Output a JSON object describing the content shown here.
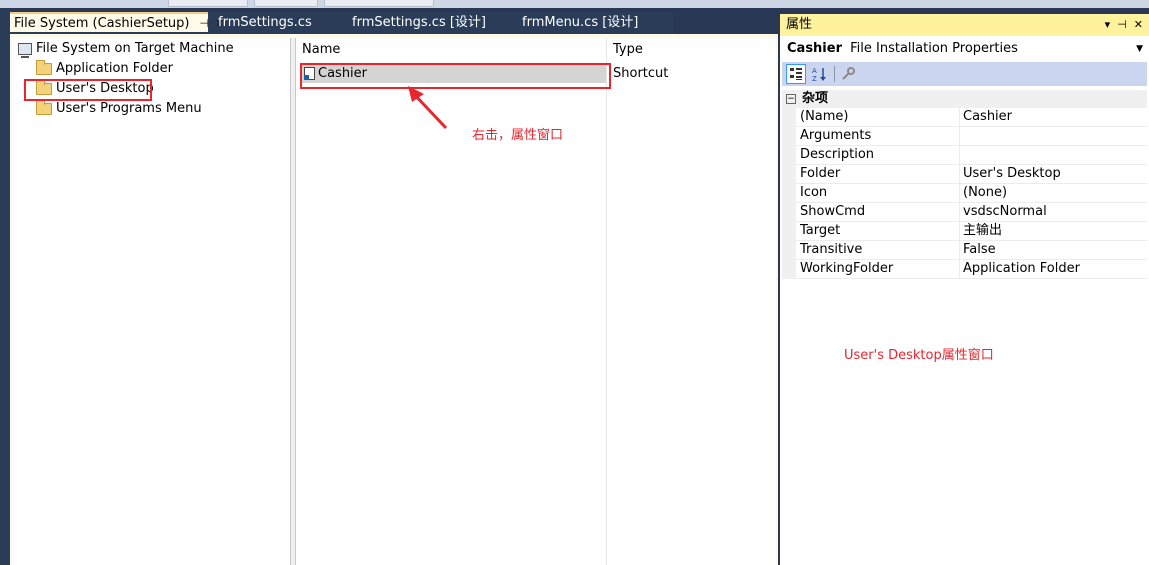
{
  "document_tabs": [
    {
      "label": "File System (CashierSetup)",
      "active": true,
      "pin": "⊣",
      "close": "✕"
    },
    {
      "label": "frmSettings.cs",
      "active": false
    },
    {
      "label": "frmSettings.cs [设计]",
      "active": false
    },
    {
      "label": "frmMenu.cs [设计]",
      "active": false
    }
  ],
  "tree": {
    "root": "File System on Target Machine",
    "items": [
      "Application Folder",
      "User's Desktop",
      "User's Programs Menu"
    ]
  },
  "list": {
    "columns": [
      "Name",
      "Type"
    ],
    "rows": [
      {
        "name": "Cashier",
        "type": "Shortcut"
      }
    ]
  },
  "annotations": {
    "list_note": "右击，属性窗口",
    "props_note": "User's Desktop属性窗口"
  },
  "properties": {
    "title": "属性",
    "title_buttons": [
      "▾",
      "⊣",
      "✕"
    ],
    "object_name": "Cashier",
    "object_type": "File Installation Properties",
    "category": "杂项",
    "category_toggle": "−",
    "rows": [
      {
        "name": "(Name)",
        "value": "Cashier"
      },
      {
        "name": "Arguments",
        "value": ""
      },
      {
        "name": "Description",
        "value": ""
      },
      {
        "name": "Folder",
        "value": "User's Desktop"
      },
      {
        "name": "Icon",
        "value": "(None)"
      },
      {
        "name": "ShowCmd",
        "value": "vsdscNormal"
      },
      {
        "name": "Target",
        "value": "主输出"
      },
      {
        "name": "Transitive",
        "value": "False"
      },
      {
        "name": "WorkingFolder",
        "value": "Application Folder"
      }
    ]
  },
  "colors": {
    "ide_background": "#293955",
    "active_tab": "#fffbe8",
    "props_title": "#fff29d",
    "annotation_red": "#e8262e",
    "selection": "#d4d4d4"
  }
}
